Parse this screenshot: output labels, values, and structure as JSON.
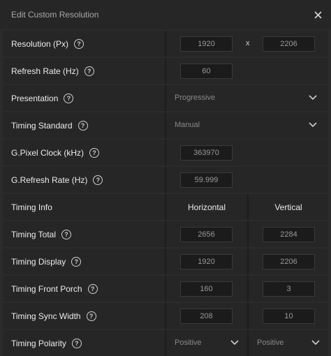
{
  "dialog": {
    "title": "Edit Custom Resolution"
  },
  "help_glyph": "?",
  "rows": {
    "resolution": {
      "label": "Resolution (Px)",
      "width": "1920",
      "separator": "x",
      "height": "2206"
    },
    "refresh_rate": {
      "label": "Refresh Rate (Hz)",
      "value": "60"
    },
    "presentation": {
      "label": "Presentation",
      "selected": "Progressive"
    },
    "timing_standard": {
      "label": "Timing Standard",
      "selected": "Manual"
    },
    "pixel_clock": {
      "label": "G.Pixel Clock (kHz)",
      "value": "363970"
    },
    "g_refresh": {
      "label": "G.Refresh Rate (Hz)",
      "value": "59.999"
    },
    "timing_info": {
      "label": "Timing Info",
      "horizontal": "Horizontal",
      "vertical": "Vertical"
    },
    "timing_total": {
      "label": "Timing Total",
      "h": "2656",
      "v": "2284"
    },
    "timing_display": {
      "label": "Timing Display",
      "h": "1920",
      "v": "2206"
    },
    "front_porch": {
      "label": "Timing Front Porch",
      "h": "160",
      "v": "3"
    },
    "sync_width": {
      "label": "Timing Sync Width",
      "h": "208",
      "v": "10"
    },
    "polarity": {
      "label": "Timing Polarity",
      "h": "Positive",
      "v": "Positive"
    }
  },
  "icons": {
    "close": "close-icon",
    "help": "help-icon",
    "dropdown": "chevron-down-icon"
  }
}
